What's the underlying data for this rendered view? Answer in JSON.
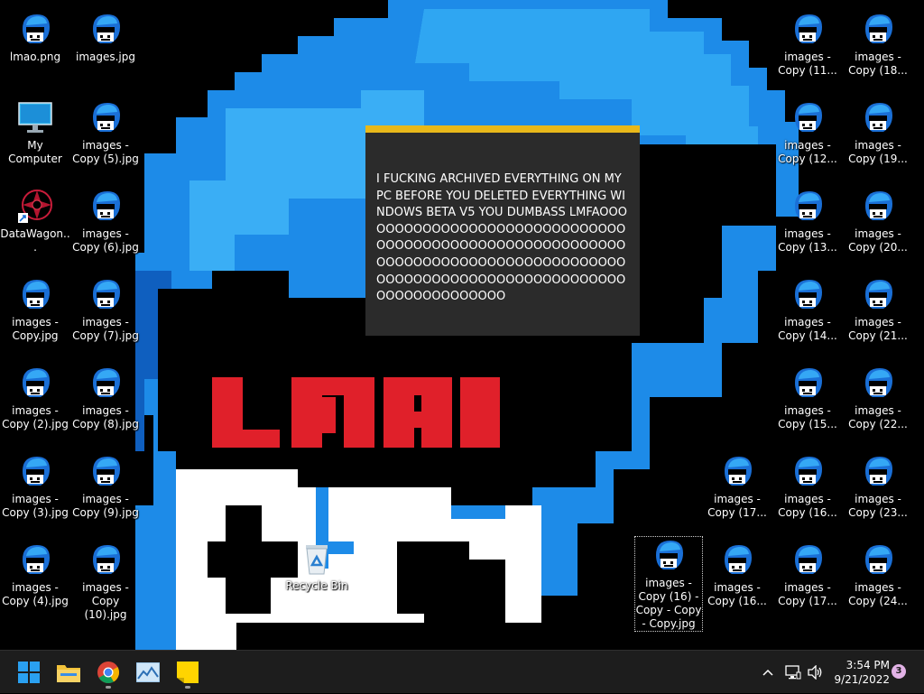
{
  "desktop": {
    "wallpaper_text": "LMAO",
    "icons_left": [
      {
        "label": "lmao.png",
        "icon": "alien-image-icon"
      },
      {
        "label": "images.jpg",
        "icon": "alien-image-icon"
      },
      {
        "label": "My Computer",
        "icon": "monitor-icon"
      },
      {
        "label": "images -\nCopy (5).jpg",
        "icon": "alien-image-icon"
      },
      {
        "label": "DataWagon...",
        "icon": "red-emblem-shortcut-icon"
      },
      {
        "label": "images -\nCopy (6).jpg",
        "icon": "alien-image-icon"
      },
      {
        "label": "images -\nCopy.jpg",
        "icon": "alien-image-icon"
      },
      {
        "label": "images -\nCopy (7).jpg",
        "icon": "alien-image-icon"
      },
      {
        "label": "images -\nCopy (2).jpg",
        "icon": "alien-image-icon"
      },
      {
        "label": "images -\nCopy (8).jpg",
        "icon": "alien-image-icon"
      },
      {
        "label": "images -\nCopy (3).jpg",
        "icon": "alien-image-icon"
      },
      {
        "label": "images -\nCopy (9).jpg",
        "icon": "alien-image-icon"
      },
      {
        "label": "images -\nCopy (4).jpg",
        "icon": "alien-image-icon"
      },
      {
        "label": "images -\nCopy (10).jpg",
        "icon": "alien-image-icon"
      }
    ],
    "icons_right": [
      {
        "label": "images -\nCopy (11...",
        "icon": "alien-image-icon"
      },
      {
        "label": "images -\nCopy (18...",
        "icon": "alien-image-icon"
      },
      {
        "label": "images -\nCopy (12...",
        "icon": "alien-image-icon"
      },
      {
        "label": "images -\nCopy (19...",
        "icon": "alien-image-icon"
      },
      {
        "label": "images -\nCopy (13...",
        "icon": "alien-image-icon"
      },
      {
        "label": "images -\nCopy (20...",
        "icon": "alien-image-icon"
      },
      {
        "label": "images -\nCopy (14...",
        "icon": "alien-image-icon"
      },
      {
        "label": "images -\nCopy (21...",
        "icon": "alien-image-icon"
      },
      {
        "label": "images -\nCopy (15...",
        "icon": "alien-image-icon"
      },
      {
        "label": "images -\nCopy (22...",
        "icon": "alien-image-icon"
      },
      {
        "label": "images -\nCopy (17...",
        "icon": "alien-image-icon"
      },
      {
        "label": "images -\nCopy (16...",
        "icon": "alien-image-icon"
      },
      {
        "label": "images -\nCopy (23...",
        "icon": "alien-image-icon"
      },
      {
        "label": "images -\nCopy (16) -\nCopy - Copy\n- Copy.jpg",
        "icon": "alien-image-icon",
        "selected": true
      },
      {
        "label": "images -\nCopy (16...",
        "icon": "alien-image-icon"
      },
      {
        "label": "images -\nCopy (17...",
        "icon": "alien-image-icon"
      },
      {
        "label": "images -\nCopy (24...",
        "icon": "alien-image-icon"
      }
    ],
    "recycle_bin": {
      "label": "Recycle Bin",
      "icon": "recycle-bin-icon"
    }
  },
  "notification": {
    "accent_color": "#e8b81a",
    "text": "I FUCKING ARCHIVED EVERYTHING ON MY PC BEFORE YOU DELETED EVERYTHING WINDOWS BETA V5 YOU DUMBASS LMFAOOOOOOOOOOOOOOOOOOOOOOOOOOOOOOOOOOOOOOOOOOOOOOOOOOOOOOOOOOOOOOOOOOOOOOOOOOOOOOOOOOOOOOOOOOOOOOOOOOOOOOOOOOOOOOOOOOOOOOOOOOOOO"
  },
  "taskbar": {
    "apps": [
      {
        "name": "start",
        "icon": "windows-start-icon",
        "running": false
      },
      {
        "name": "file-explorer",
        "icon": "folder-icon",
        "running": false
      },
      {
        "name": "chrome",
        "icon": "chrome-icon",
        "running": true
      },
      {
        "name": "photos",
        "icon": "photo-app-icon",
        "running": false
      },
      {
        "name": "sticky-notes",
        "icon": "sticky-notes-icon",
        "running": true
      }
    ],
    "tray": {
      "time": "3:54 PM",
      "date": "9/21/2022",
      "notification_count": "3"
    }
  }
}
